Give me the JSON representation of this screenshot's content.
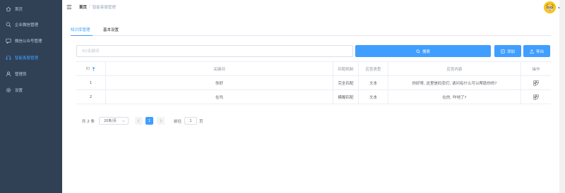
{
  "sidebar": {
    "items": [
      {
        "label": "首页",
        "icon": "home-icon"
      },
      {
        "label": "企业微信管理",
        "icon": "search-icon"
      },
      {
        "label": "微信公众号管理",
        "icon": "message-icon"
      },
      {
        "label": "智能客服管理",
        "icon": "headset-icon",
        "active": true
      },
      {
        "label": "管理员",
        "icon": "user-icon"
      },
      {
        "label": "设置",
        "icon": "gear-icon"
      }
    ]
  },
  "header": {
    "breadcrumb": {
      "home": "首页",
      "separator": "/",
      "current": "智能客服管理"
    }
  },
  "tabs": [
    {
      "label": "知识库管理",
      "active": true
    },
    {
      "label": "基本设置",
      "active": false
    }
  ],
  "toolbar": {
    "search_placeholder": "ID/关键词",
    "search_label": "搜索",
    "add_label": "添加",
    "export_label": "导出"
  },
  "table": {
    "columns": [
      "ID",
      "关键词",
      "匹配机制",
      "应答类型",
      "应答内容",
      "操作"
    ],
    "rows": [
      {
        "id": "1",
        "keyword": "你好",
        "match": "完全匹配",
        "type": "文本",
        "content": "你好呀, 这里是码农们, 请问有什么可以帮助你的?"
      },
      {
        "id": "2",
        "keyword": "在吗",
        "match": "模糊匹配",
        "type": "文本",
        "content": "在的, 咋地了?"
      }
    ]
  },
  "pagination": {
    "total": "共 2 条",
    "page_size": "20条/页",
    "current_page": "1",
    "goto_label": "前往",
    "goto_value": "1",
    "page_suffix": "页"
  },
  "colors": {
    "sidebar_bg": "#304156",
    "accent": "#409eff",
    "menu_text": "#bfcbd9"
  }
}
